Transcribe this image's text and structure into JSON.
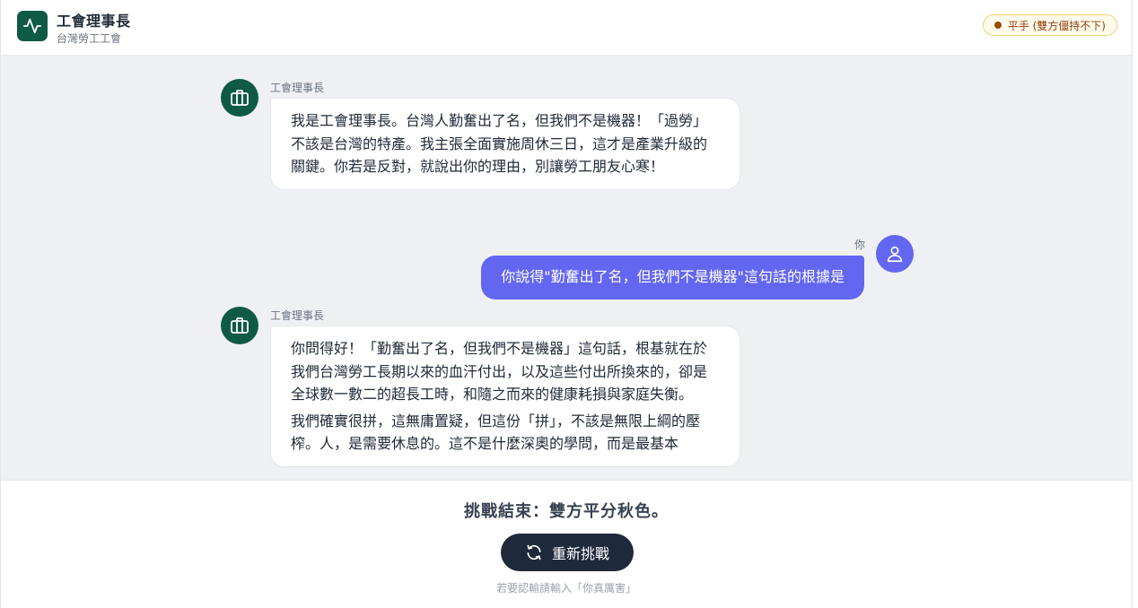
{
  "header": {
    "title": "工會理事長",
    "subtitle": "台灣勞工工會",
    "logo_icon": "pulse-icon",
    "status": {
      "label": "平手 (雙方僵持不下)",
      "dot_color": "#9a4a0a"
    }
  },
  "chat": {
    "messages": [
      {
        "role": "bot",
        "sender": "工會理事長",
        "avatar_icon": "briefcase-icon",
        "paragraphs": [
          "我是工會理事長。台灣人勤奮出了名，但我們不是機器！「過勞」不該是台灣的特產。我主張全面實施周休三日，這才是產業升級的關鍵。你若是反對，就說出你的理由，別讓勞工朋友心寒！"
        ]
      },
      {
        "role": "user",
        "sender": "你",
        "avatar_icon": "user-icon",
        "paragraphs": [
          "你說得\"勤奮出了名，但我們不是機器\"這句話的根據是"
        ]
      },
      {
        "role": "bot",
        "sender": "工會理事長",
        "avatar_icon": "briefcase-icon",
        "paragraphs": [
          "你問得好！「勤奮出了名，但我們不是機器」這句話，根基就在於我們台灣勞工長期以來的血汗付出，以及這些付出所換來的，卻是全球數一數二的超長工時，和隨之而來的健康耗損與家庭失衡。",
          "我們確實很拼，這無庸置疑，但這份「拼」，不該是無限上綱的壓榨。人，是需要休息的。這不是什麼深奧的學問，而是最基本"
        ]
      }
    ]
  },
  "footer": {
    "result": "挑戰結束：雙方平分秋色。",
    "retry_button_label": "重新挑戰",
    "retry_icon": "refresh-icon",
    "hint": "若要認輸請輸入「你真厲害」"
  },
  "colors": {
    "brand": "#0f5a45",
    "user_bubble": "#6366f1",
    "button": "#1e293b"
  }
}
